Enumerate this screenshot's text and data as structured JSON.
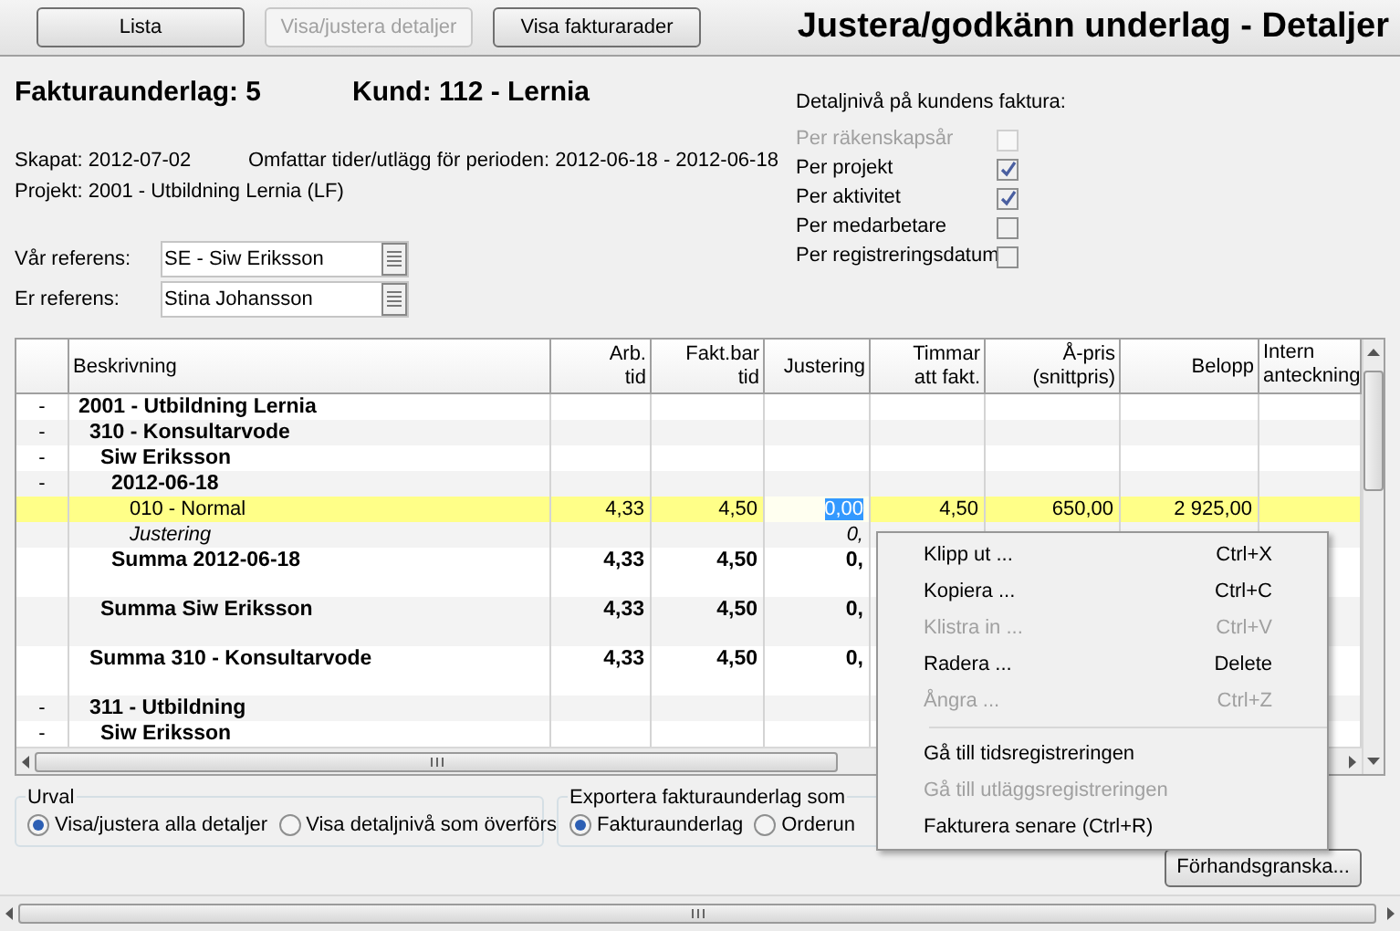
{
  "toolbar": {
    "buttons": [
      {
        "label": "Lista",
        "disabled": false
      },
      {
        "label": "Visa/justera detaljer",
        "disabled": true
      },
      {
        "label": "Visa fakturarader",
        "disabled": false
      }
    ],
    "title": "Justera/godkänn underlag - Detaljer"
  },
  "header": {
    "invoice": "Fakturaunderlag: 5",
    "customer": "Kund: 112 - Lernia",
    "created": "Skapat: 2012-07-02",
    "period": "Omfattar tider/utlägg för perioden: 2012-06-18 - 2012-06-18",
    "project": "Projekt: 2001 - Utbildning Lernia (LF)"
  },
  "references": [
    {
      "label": "Vår referens:",
      "value": "SE - Siw Eriksson"
    },
    {
      "label": "Er referens:",
      "value": "Stina Johansson"
    }
  ],
  "detail_level": {
    "title": "Detaljnivå på kundens faktura:",
    "options": [
      {
        "label": "Per räkenskapsår",
        "checked": false,
        "disabled": true
      },
      {
        "label": "Per projekt",
        "checked": true,
        "disabled": false
      },
      {
        "label": "Per aktivitet",
        "checked": true,
        "disabled": false
      },
      {
        "label": "Per medarbetare",
        "checked": false,
        "disabled": false
      },
      {
        "label": "Per registreringsdatum",
        "checked": false,
        "disabled": false
      }
    ]
  },
  "table": {
    "columns": [
      {
        "lines": [
          "Beskrivning"
        ]
      },
      {
        "lines": [
          "Arb.",
          "tid"
        ]
      },
      {
        "lines": [
          "Fakt.bar",
          "tid"
        ]
      },
      {
        "lines": [
          "Justering"
        ]
      },
      {
        "lines": [
          "Timmar",
          "att fakt."
        ]
      },
      {
        "lines": [
          "Å-pris",
          "(snittpris)"
        ]
      },
      {
        "lines": [
          "Belopp"
        ]
      },
      {
        "lines": [
          "Intern",
          "anteckning"
        ]
      }
    ],
    "rows": [
      {
        "kind": "group",
        "toggle": "-",
        "label": "2001 - Utbildning Lernia",
        "selected": false,
        "children": [
          {
            "kind": "group",
            "toggle": "-",
            "label": "310 - Konsultarvode",
            "selected": false,
            "children": [
              {
                "kind": "group",
                "toggle": "-",
                "label": "Siw Eriksson",
                "selected": false,
                "children": [
                  {
                    "kind": "group",
                    "toggle": "-",
                    "label": "2012-06-18",
                    "selected": false,
                    "children": [
                      {
                        "kind": "item",
                        "label": "010 - Normal",
                        "selected": true,
                        "values": [
                          {
                            "text": "4,33",
                            "selected": false
                          },
                          {
                            "text": "4,50",
                            "selected": false
                          },
                          {
                            "text": "0,00",
                            "selected": true
                          },
                          {
                            "text": "4,50",
                            "selected": false
                          },
                          {
                            "text": "650,00",
                            "selected": false
                          },
                          {
                            "text": "2 925,00",
                            "selected": false
                          }
                        ]
                      },
                      {
                        "kind": "adjustment",
                        "label": "Justering",
                        "selected": false,
                        "values": [
                          {
                            "text": "0,",
                            "selected": false
                          }
                        ]
                      }
                    ]
                  },
                  {
                    "kind": "sum",
                    "label": "Summa 2012-06-18",
                    "selected": false,
                    "values": [
                      {
                        "text": "4,33",
                        "selected": false
                      },
                      {
                        "text": "4,50",
                        "selected": false
                      },
                      {
                        "text": "0,",
                        "selected": false
                      }
                    ]
                  }
                ]
              },
              {
                "kind": "sum",
                "label": "Summa Siw Eriksson",
                "selected": false,
                "values": [
                  {
                    "text": "4,33",
                    "selected": false
                  },
                  {
                    "text": "4,50",
                    "selected": false
                  },
                  {
                    "text": "0,",
                    "selected": false
                  }
                ]
              }
            ]
          },
          {
            "kind": "sum",
            "label": "Summa 310 - Konsultarvode",
            "selected": false,
            "values": [
              {
                "text": "4,33",
                "selected": false
              },
              {
                "text": "4,50",
                "selected": false
              },
              {
                "text": "0,",
                "selected": false
              }
            ]
          },
          {
            "kind": "group",
            "toggle": "-",
            "label": "311 - Utbildning",
            "selected": false,
            "children": [
              {
                "kind": "group",
                "toggle": "-",
                "label": "Siw Eriksson",
                "selected": false
              }
            ]
          }
        ]
      }
    ]
  },
  "urval": {
    "title": "Urval",
    "options": [
      {
        "label": "Visa/justera alla detaljer",
        "selected": true
      },
      {
        "label": "Visa detaljnivå som överförs",
        "selected": false
      }
    ]
  },
  "export": {
    "title": "Exportera fakturaunderlag som",
    "options": [
      {
        "label": "Fakturaunderlag",
        "selected": true
      },
      {
        "label": "Orderun",
        "selected": false
      }
    ]
  },
  "preview_button": "Förhandsgranska...",
  "context_menu": [
    {
      "kind": "item",
      "label": "Klipp ut ...",
      "shortcut": "Ctrl+X",
      "disabled": false
    },
    {
      "kind": "item",
      "label": "Kopiera ...",
      "shortcut": "Ctrl+C",
      "disabled": false
    },
    {
      "kind": "item",
      "label": "Klistra in ...",
      "shortcut": "Ctrl+V",
      "disabled": true
    },
    {
      "kind": "item",
      "label": "Radera ...",
      "shortcut": "Delete",
      "disabled": false
    },
    {
      "kind": "item",
      "label": "Ångra ...",
      "shortcut": "Ctrl+Z",
      "disabled": true
    },
    {
      "kind": "separator"
    },
    {
      "kind": "item",
      "label": "Gå till tidsregistreringen",
      "disabled": false
    },
    {
      "kind": "item",
      "label": "Gå till utläggsregistreringen",
      "disabled": true
    },
    {
      "kind": "item",
      "label": "Fakturera senare (Ctrl+R)",
      "disabled": false
    }
  ]
}
